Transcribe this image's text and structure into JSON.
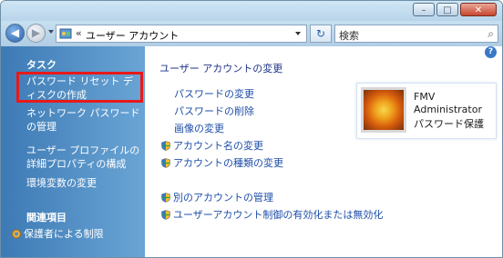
{
  "window": {
    "buttons": {
      "minimize": "–",
      "maximize": "□",
      "close": "✕"
    }
  },
  "navbar": {
    "breadcrumb_sep": "«",
    "address": "ユーザー アカウント",
    "search_placeholder": "検索",
    "refresh_icon": "↻"
  },
  "sidebar": {
    "tasks_heading": "タスク",
    "items": [
      {
        "label": "パスワード リセット ディスクの作成"
      },
      {
        "label": "ネットワーク パスワードの管理"
      },
      {
        "label": "ユーザー プロファイルの詳細プロパティの構成"
      },
      {
        "label": "環境変数の変更"
      }
    ],
    "related_heading": "関連項目",
    "related_items": [
      {
        "label": "保護者による制限"
      }
    ]
  },
  "main": {
    "help_icon": "?",
    "section_title": "ユーザー アカウントの変更",
    "tasks": [
      {
        "label": "パスワードの変更",
        "shield": false
      },
      {
        "label": "パスワードの削除",
        "shield": false
      },
      {
        "label": "画像の変更",
        "shield": false
      },
      {
        "label": "アカウント名の変更",
        "shield": true
      },
      {
        "label": "アカウントの種類の変更",
        "shield": true
      }
    ],
    "other_tasks": [
      {
        "label": "別のアカウントの管理",
        "shield": true
      },
      {
        "label": "ユーザーアカウント制御の有効化または無効化",
        "shield": true
      }
    ]
  },
  "user_card": {
    "name": "FMV",
    "role": "Administrator",
    "status": "パスワード保護"
  },
  "colors": {
    "sidebar_gradient_start": "#3d7ab5",
    "sidebar_gradient_end": "#6aa5d5",
    "highlight_border": "#e8191a",
    "link": "#1e4ea8"
  }
}
